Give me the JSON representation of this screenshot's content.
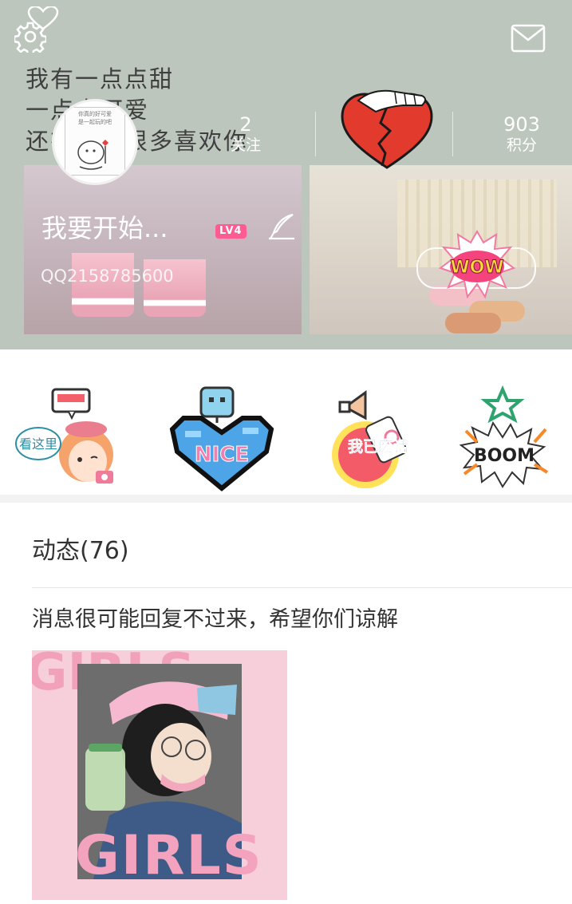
{
  "header": {
    "background_text": "我有一点点甜\n一点点可爱\n还有很多很多喜欢你",
    "icons": {
      "settings": "gear-icon",
      "favorite": "heart-outline-icon",
      "messages": "mail-icon",
      "edit": "feather-pen-icon"
    },
    "stats": {
      "following_count": "2",
      "following_label": "关注",
      "points_count": "903",
      "points_label": "积分"
    },
    "nickname": "我要开始...",
    "level": "LV4",
    "account_id": "QQ2158785600",
    "avatar_caption_line1": "你真的好可爱",
    "avatar_caption_line2": "是一起玩的吧"
  },
  "stickers": [
    {
      "name": "看这里",
      "icon": "girl-look-here-sticker"
    },
    {
      "name": "NICE",
      "icon": "pixel-heart-nice-sticker"
    },
    {
      "name": "我已废话",
      "icon": "megaphone-sticker"
    },
    {
      "name": "BOOM",
      "icon": "boom-star-sticker"
    }
  ],
  "feed": {
    "title": "动态(76)",
    "post_text": "消息很可能回复不过来，希望你们谅解",
    "image_text_bg": "GIRLS",
    "image_text_bottom": "GIRLS"
  },
  "wow_label": "WOW",
  "colors": {
    "header_bg": "#bcc6bd",
    "level_badge": "#ff5b93",
    "text_dark": "#333333",
    "separator": "#e6e6e6"
  }
}
